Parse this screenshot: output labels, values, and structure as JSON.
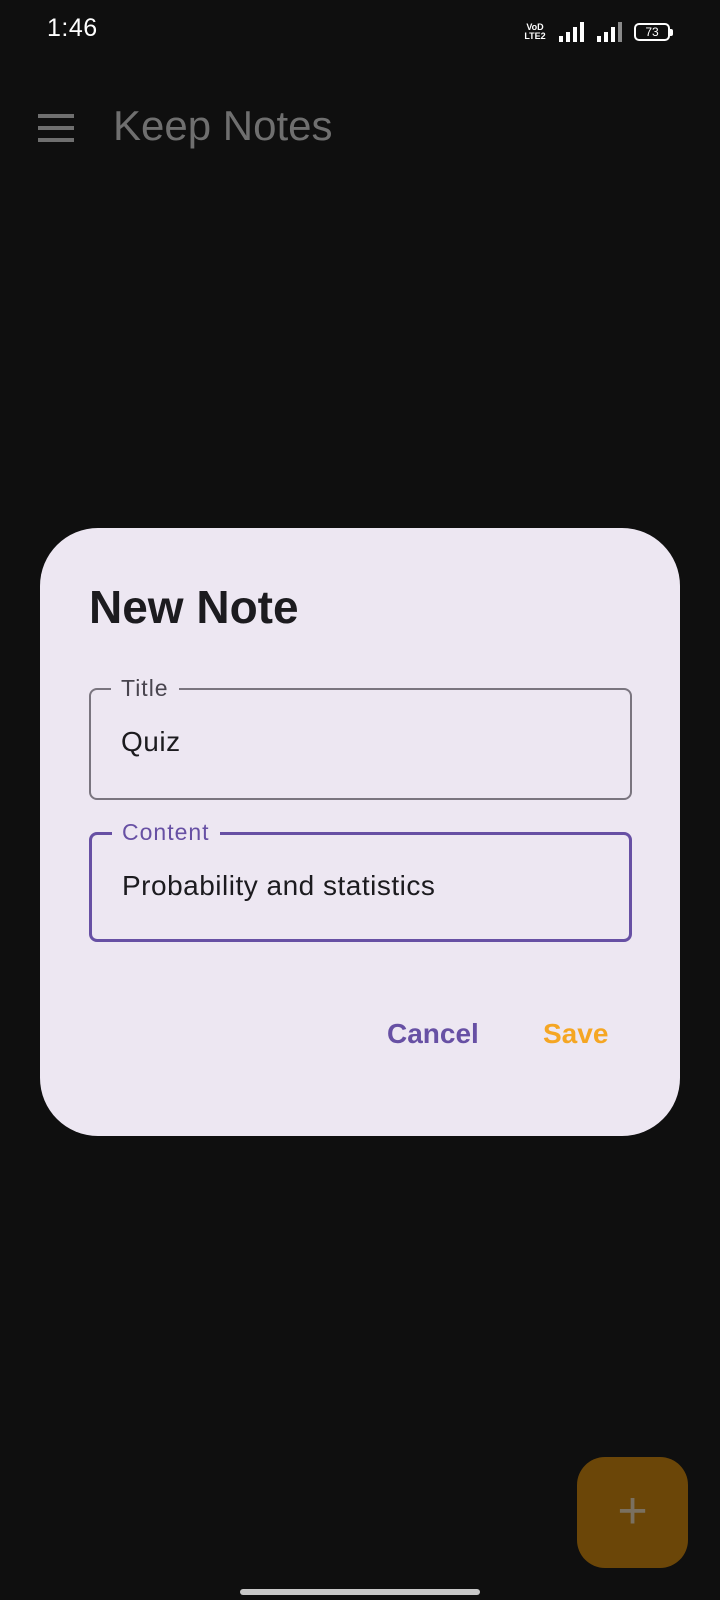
{
  "status_bar": {
    "time": "1:46",
    "network_label": "VoD LTE2",
    "battery_level": "73"
  },
  "app_bar": {
    "title": "Keep Notes",
    "menu_icon": "hamburger-menu-icon"
  },
  "dialog": {
    "title": "New Note",
    "title_field": {
      "label": "Title",
      "value": "Quiz"
    },
    "content_field": {
      "label": "Content",
      "value": "Probability and statistics"
    },
    "cancel_label": "Cancel",
    "save_label": "Save"
  },
  "fab": {
    "icon": "plus-icon",
    "glyph": "+"
  },
  "colors": {
    "background": "#0f0f0f",
    "dialog_surface": "#ede7f2",
    "primary": "#6750a4",
    "accent": "#f5a623"
  }
}
